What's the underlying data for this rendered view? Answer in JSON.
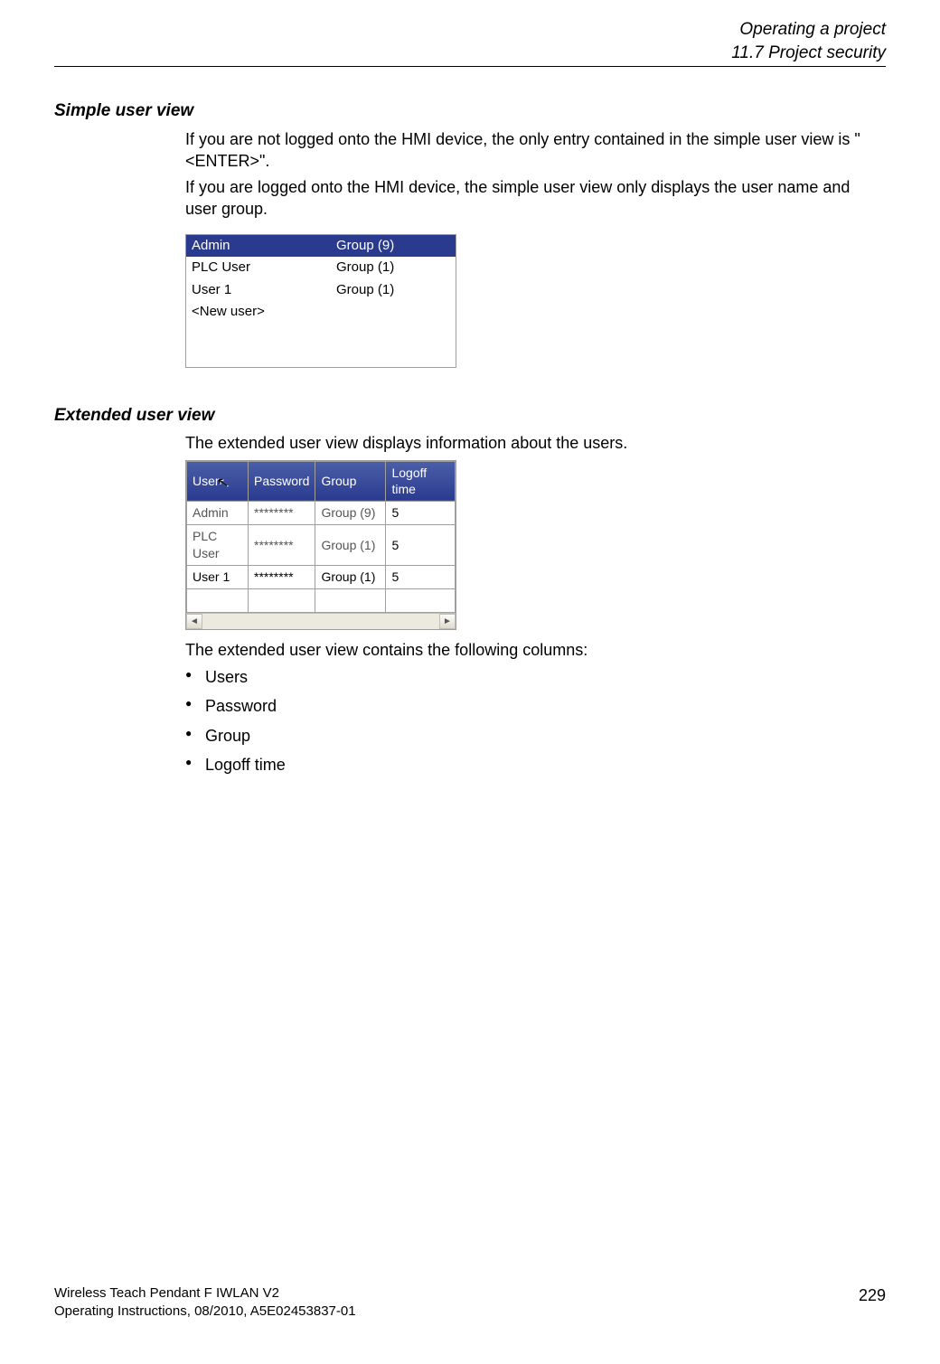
{
  "header": {
    "chapter": "Operating a project",
    "section": "11.7 Project security"
  },
  "simple": {
    "heading": "Simple user view",
    "para1": "If you are not logged onto the HMI device, the only entry contained in the simple user view is \"<ENTER>\".",
    "para2": "If you are logged onto the HMI device, the simple user view only displays the user name and user group.",
    "rows": [
      {
        "user": "Admin",
        "group": "Group (9)",
        "selected": true
      },
      {
        "user": "PLC User",
        "group": "Group (1)",
        "selected": false
      },
      {
        "user": "User 1",
        "group": "Group (1)",
        "selected": false
      },
      {
        "user": "<New user>",
        "group": "",
        "selected": false
      }
    ]
  },
  "extended": {
    "heading": "Extended user view",
    "para1": "The extended user view displays information about the users.",
    "columns": {
      "c1": "User",
      "c2": "Password",
      "c3": "Group",
      "c4": "Logoff time"
    },
    "rows": [
      {
        "user": "Admin",
        "password": "********",
        "group": "Group (9)",
        "logoff": "5"
      },
      {
        "user": "PLC User",
        "password": "********",
        "group": "Group (1)",
        "logoff": "5"
      },
      {
        "user": "User 1",
        "password": "********",
        "group": "Group (1)",
        "logoff": "5"
      }
    ],
    "after": "The extended user view contains the following columns:",
    "list": {
      "i1": "Users",
      "i2": "Password",
      "i3": "Group",
      "i4": "Logoff time"
    }
  },
  "footer": {
    "line1": "Wireless Teach Pendant F IWLAN V2",
    "line2": "Operating Instructions, 08/2010, A5E02453837-01",
    "page": "229"
  }
}
